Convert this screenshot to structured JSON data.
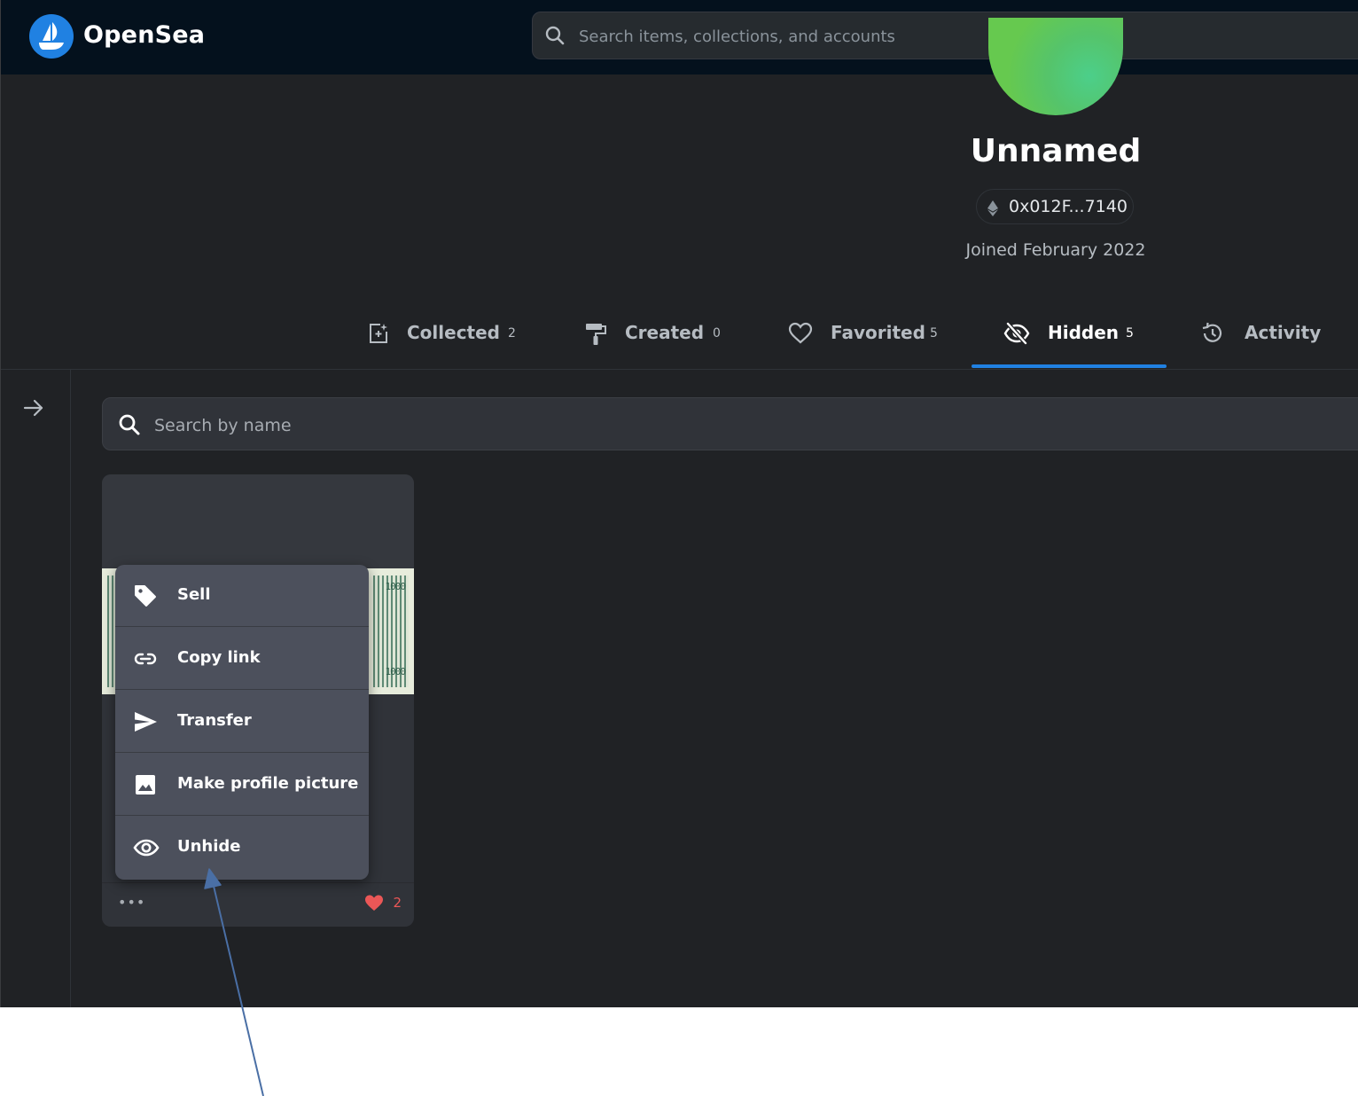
{
  "header": {
    "brand": "OpenSea",
    "search_placeholder": "Search items, collections, and accounts"
  },
  "profile": {
    "name": "Unnamed",
    "address": "0x012F...7140",
    "joined": "Joined February 2022"
  },
  "tabs": [
    {
      "label": "Collected",
      "count": "2",
      "icon": "collected-icon"
    },
    {
      "label": "Created",
      "count": "0",
      "icon": "paint-roller-icon"
    },
    {
      "label": "Favorited",
      "count": "5",
      "icon": "heart-icon"
    },
    {
      "label": "Hidden",
      "count": "5",
      "icon": "eye-off-icon",
      "active": true
    },
    {
      "label": "Activity",
      "count": "",
      "icon": "history-icon"
    }
  ],
  "filter": {
    "search_placeholder": "Search by name"
  },
  "card": {
    "more_label": "•••",
    "likes": "2",
    "image_text": [
      "1000",
      "1000"
    ]
  },
  "context_menu": {
    "items": [
      {
        "label": "Sell",
        "icon": "tag-icon"
      },
      {
        "label": "Copy link",
        "icon": "link-icon"
      },
      {
        "label": "Transfer",
        "icon": "send-icon"
      },
      {
        "label": "Make profile picture",
        "icon": "image-icon"
      },
      {
        "label": "Unhide",
        "icon": "eye-icon"
      }
    ]
  },
  "colors": {
    "background": "#202225",
    "topbar": "#04111d",
    "accent": "#2081e2",
    "menu": "#4c505c",
    "like": "#eb5757",
    "annotation_arrow": "#4a6fa5"
  }
}
